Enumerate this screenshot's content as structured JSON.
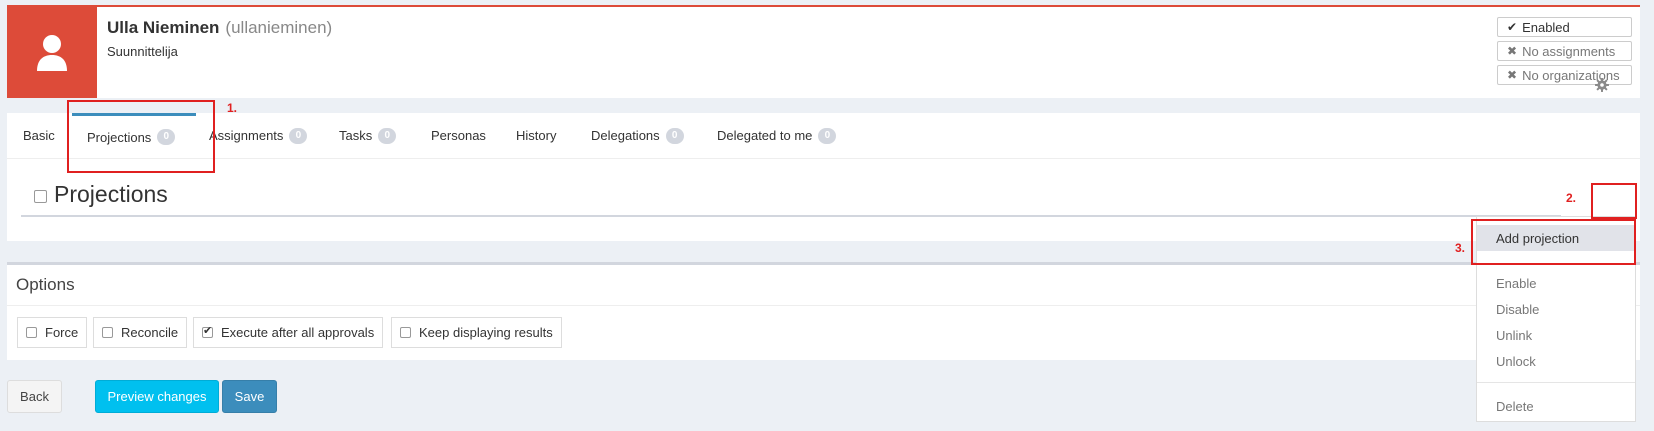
{
  "user": {
    "name": "Ulla Nieminen",
    "login": "(ullanieminen)",
    "title": "Suunnittelija",
    "avatar_icon": "user-icon"
  },
  "status": [
    {
      "mark": "✔",
      "label": "Enabled",
      "kind": "ok"
    },
    {
      "mark": "✖",
      "label": "No assignments",
      "kind": "muted"
    },
    {
      "mark": "✖",
      "label": "No organizations",
      "kind": "muted"
    }
  ],
  "tabs": [
    {
      "label": "Basic",
      "count": null
    },
    {
      "label": "Projections",
      "count": "0"
    },
    {
      "label": "Assignments",
      "count": "0"
    },
    {
      "label": "Tasks",
      "count": "0"
    },
    {
      "label": "Personas",
      "count": null
    },
    {
      "label": "History",
      "count": null
    },
    {
      "label": "Delegations",
      "count": "0"
    },
    {
      "label": "Delegated to me",
      "count": "0"
    }
  ],
  "section": {
    "title": "Projections",
    "gear_icon": "gear-icon"
  },
  "dropdown": {
    "items": [
      "Add projection",
      "Enable",
      "Disable",
      "Unlink",
      "Unlock",
      "Delete"
    ]
  },
  "options": {
    "title": "Options",
    "items": [
      {
        "label": "Force",
        "checked": false
      },
      {
        "label": "Reconcile",
        "checked": false
      },
      {
        "label": "Execute after all approvals",
        "checked": true
      },
      {
        "label": "Keep displaying results",
        "checked": false
      }
    ]
  },
  "buttons": {
    "back": "Back",
    "preview": "Preview changes",
    "save": "Save"
  },
  "annotations": {
    "step1": "1.",
    "step2": "2.",
    "step3": "3."
  },
  "colors": {
    "accent_red": "#dd4b39",
    "tab_active": "#3c8dbc",
    "preview": "#00c0ef",
    "save": "#3c8dbc",
    "annotation": "#e02020"
  }
}
